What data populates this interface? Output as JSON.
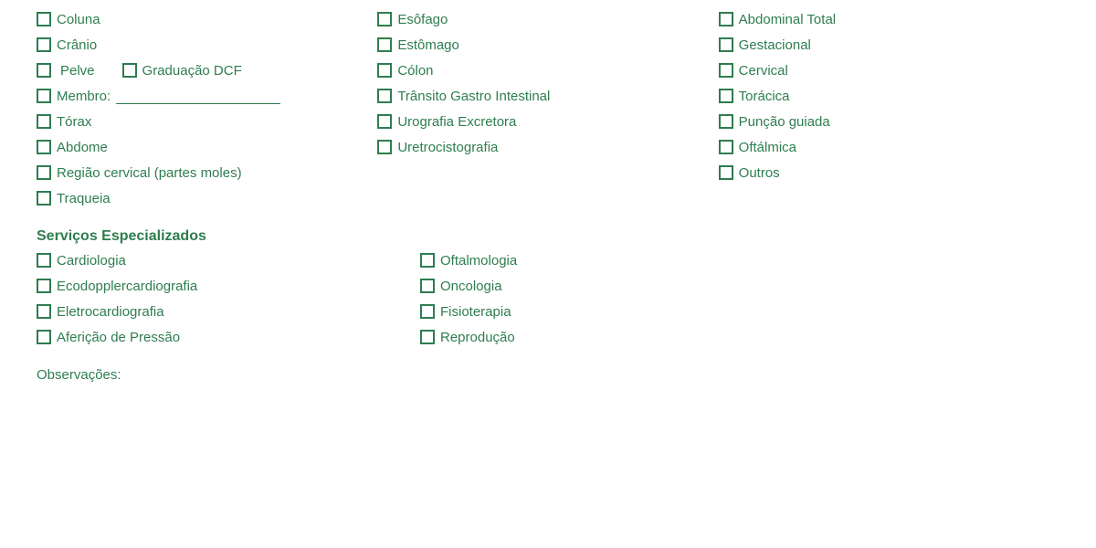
{
  "col1": {
    "items": [
      {
        "id": "coluna",
        "label": "Coluna"
      },
      {
        "id": "cranio",
        "label": "Crânio"
      },
      {
        "id": "pelve",
        "label": "Pelve"
      },
      {
        "id": "membro",
        "label": "Membro:"
      },
      {
        "id": "torax",
        "label": "Tórax"
      },
      {
        "id": "abdome",
        "label": "Abdome"
      },
      {
        "id": "regiao-cervical",
        "label": "Região cervical (partes moles)"
      },
      {
        "id": "traqueia",
        "label": "Traqueia"
      }
    ],
    "pelve_extra": "Graduação DCF"
  },
  "col2": {
    "items": [
      {
        "id": "esofago",
        "label": "Esôfago"
      },
      {
        "id": "estomago",
        "label": "Estômago"
      },
      {
        "id": "colon",
        "label": "Cólon"
      },
      {
        "id": "transito",
        "label": "Trânsito Gastro Intestinal"
      },
      {
        "id": "urografia",
        "label": "Urografia Excretora"
      },
      {
        "id": "uretrocistografia",
        "label": "Uretrocistografia"
      }
    ]
  },
  "col3": {
    "items": [
      {
        "id": "abdominal-total",
        "label": "Abdominal Total"
      },
      {
        "id": "gestacional",
        "label": "Gestacional"
      },
      {
        "id": "cervical",
        "label": "Cervical"
      },
      {
        "id": "toracica",
        "label": "Torácica"
      },
      {
        "id": "puncao-guiada",
        "label": "Punção guiada"
      },
      {
        "id": "oftalmica",
        "label": "Oftálmica"
      },
      {
        "id": "outros",
        "label": "Outros"
      }
    ]
  },
  "services": {
    "title": "Serviços Especializados",
    "col1": [
      {
        "id": "cardiologia",
        "label": "Cardiologia"
      },
      {
        "id": "ecodopplercardiografia",
        "label": "Ecodopplercardiografia"
      },
      {
        "id": "eletrocardiografia",
        "label": "Eletrocardiografia"
      },
      {
        "id": "afericao",
        "label": "Aferição de Pressão"
      }
    ],
    "col2": [
      {
        "id": "oftalmologia",
        "label": "Oftalmologia"
      },
      {
        "id": "oncologia",
        "label": "Oncologia"
      },
      {
        "id": "fisioterapia",
        "label": "Fisioterapia"
      },
      {
        "id": "reproducao",
        "label": "Reprodução"
      }
    ]
  },
  "observacoes": {
    "label": "Observações:"
  }
}
